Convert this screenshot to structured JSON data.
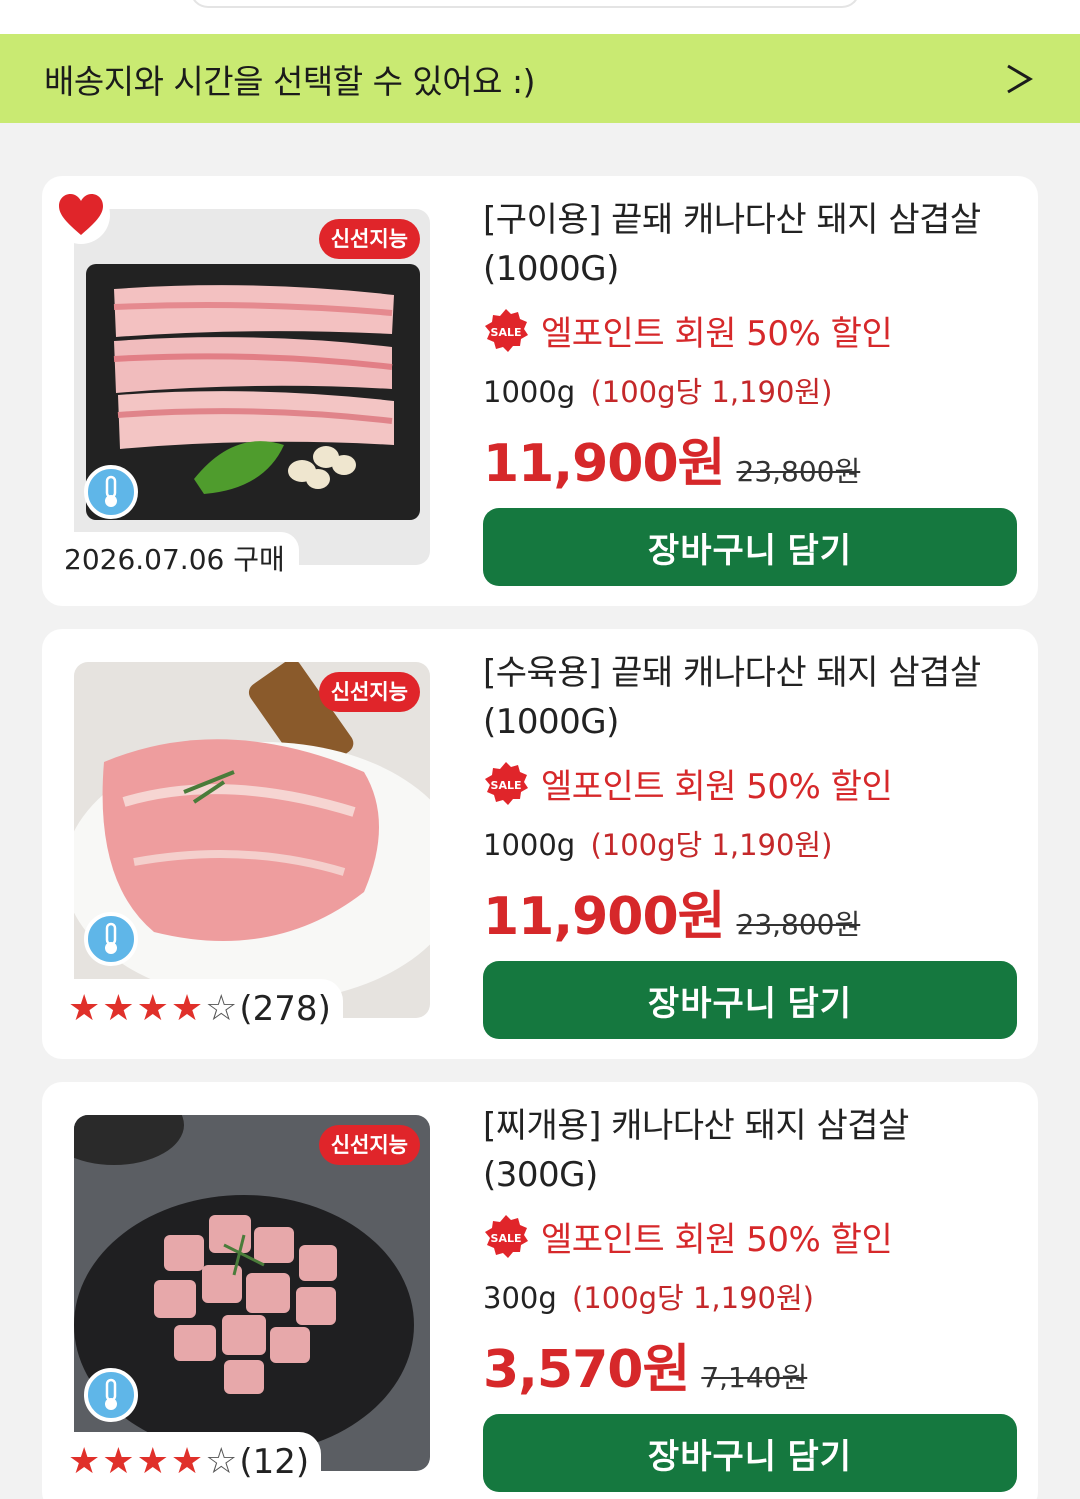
{
  "banner": {
    "text": "배송지와 시간을 선택할 수 있어요 :)",
    "arrow_icon": "chevron-right-icon"
  },
  "colors": {
    "banner_bg": "#c9ea72",
    "accent_red": "#d6282a",
    "cart_green": "#15783f",
    "temp_blue": "#5fb6e8"
  },
  "products": [
    {
      "title": "[구이용] 끝돼 캐나다산 돼지 삼겹살 (1000G)",
      "fresh_badge": "신선지능",
      "favorite": true,
      "sale_badge": "SALE",
      "sale_text": "엘포인트 회원 50% 할인",
      "weight": "1000g",
      "unit_price": "(100g당 1,190원)",
      "price": "11,900원",
      "original_price": "23,800원",
      "purchase_date": "2026.07.06 구매",
      "cart_label": "장바구니 담기"
    },
    {
      "title": "[수육용] 끝돼 캐나다산 돼지 삼겹살 (1000G)",
      "fresh_badge": "신선지능",
      "sale_badge": "SALE",
      "sale_text": "엘포인트 회원 50% 할인",
      "weight": "1000g",
      "unit_price": "(100g당 1,190원)",
      "price": "11,900원",
      "original_price": "23,800원",
      "rating": 4,
      "rating_max": 5,
      "review_count": "(278)",
      "cart_label": "장바구니 담기"
    },
    {
      "title": "[찌개용] 캐나다산 돼지 삼겹살 (300G)",
      "fresh_badge": "신선지능",
      "sale_badge": "SALE",
      "sale_text": "엘포인트 회원 50% 할인",
      "weight": "300g",
      "unit_price": "(100g당 1,190원)",
      "price": "3,570원",
      "original_price": "7,140원",
      "rating": 4,
      "rating_max": 5,
      "review_count": "(12)",
      "cart_label": "장바구니 담기"
    }
  ]
}
